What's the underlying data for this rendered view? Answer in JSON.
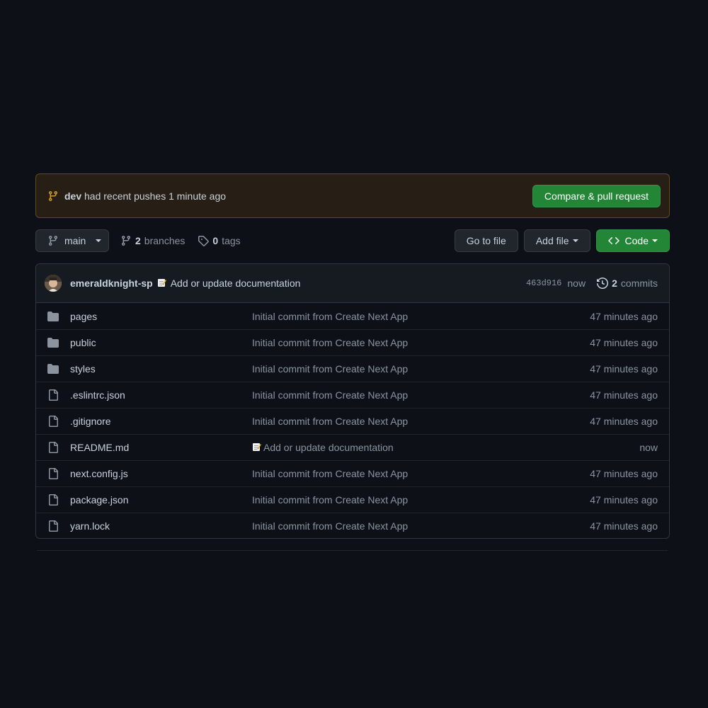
{
  "banner": {
    "branch": "dev",
    "text": "had recent pushes 1 minute ago",
    "button_label": "Compare & pull request"
  },
  "toolbar": {
    "branch_selected": "main",
    "branches_count": "2",
    "branches_label": "branches",
    "tags_count": "0",
    "tags_label": "tags",
    "go_to_file_label": "Go to file",
    "add_file_label": "Add file",
    "code_label": "Code"
  },
  "latest_commit": {
    "author": "emeraldknight-sp",
    "message": "Add or update documentation",
    "sha": "463d916",
    "time": "now",
    "commits_count": "2",
    "commits_label": "commits"
  },
  "files": [
    {
      "type": "dir",
      "name": "pages",
      "commit": "Initial commit from Create Next App",
      "age": "47 minutes ago",
      "emoji": false
    },
    {
      "type": "dir",
      "name": "public",
      "commit": "Initial commit from Create Next App",
      "age": "47 minutes ago",
      "emoji": false
    },
    {
      "type": "dir",
      "name": "styles",
      "commit": "Initial commit from Create Next App",
      "age": "47 minutes ago",
      "emoji": false
    },
    {
      "type": "file",
      "name": ".eslintrc.json",
      "commit": "Initial commit from Create Next App",
      "age": "47 minutes ago",
      "emoji": false
    },
    {
      "type": "file",
      "name": ".gitignore",
      "commit": "Initial commit from Create Next App",
      "age": "47 minutes ago",
      "emoji": false
    },
    {
      "type": "file",
      "name": "README.md",
      "commit": "Add or update documentation",
      "age": "now",
      "emoji": true
    },
    {
      "type": "file",
      "name": "next.config.js",
      "commit": "Initial commit from Create Next App",
      "age": "47 minutes ago",
      "emoji": false
    },
    {
      "type": "file",
      "name": "package.json",
      "commit": "Initial commit from Create Next App",
      "age": "47 minutes ago",
      "emoji": false
    },
    {
      "type": "file",
      "name": "yarn.lock",
      "commit": "Initial commit from Create Next App",
      "age": "47 minutes ago",
      "emoji": false
    }
  ],
  "icons": {
    "branch": "git-branch-icon",
    "tag": "tag-icon",
    "code": "code-icon",
    "history": "history-icon",
    "folder": "folder-icon",
    "file": "file-icon",
    "memo": "memo-emoji-icon"
  },
  "colors": {
    "background": "#0d1117",
    "accent_green": "#238636",
    "banner_bg": "#271f15",
    "banner_border": "#5f4a1e",
    "branch_icon_orange": "#d29922",
    "folder": "#8b949e"
  }
}
